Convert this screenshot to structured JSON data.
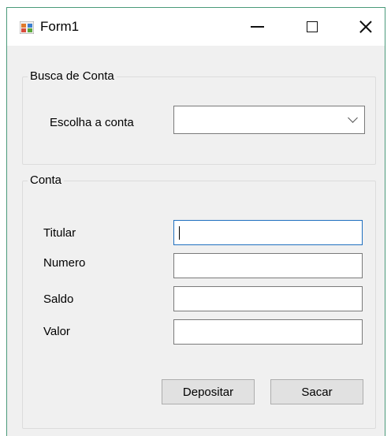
{
  "window": {
    "title": "Form1",
    "icon": "winforms-app-icon"
  },
  "title_buttons": {
    "minimize": "minimize-icon",
    "maximize": "maximize-icon",
    "close": "close-icon"
  },
  "busca": {
    "legend": "Busca de Conta",
    "label": "Escolha a conta",
    "combo_value": ""
  },
  "conta": {
    "legend": "Conta",
    "fields": [
      {
        "label": "Titular",
        "value": ""
      },
      {
        "label": "Numero",
        "value": ""
      },
      {
        "label": "Saldo",
        "value": ""
      },
      {
        "label": "Valor",
        "value": ""
      }
    ],
    "buttons": {
      "depositar": "Depositar",
      "sacar": "Sacar"
    }
  },
  "colors": {
    "window_border": "#4a9a7a",
    "focus_border": "#1f6fbf",
    "form_bg": "#f0f0f0"
  }
}
